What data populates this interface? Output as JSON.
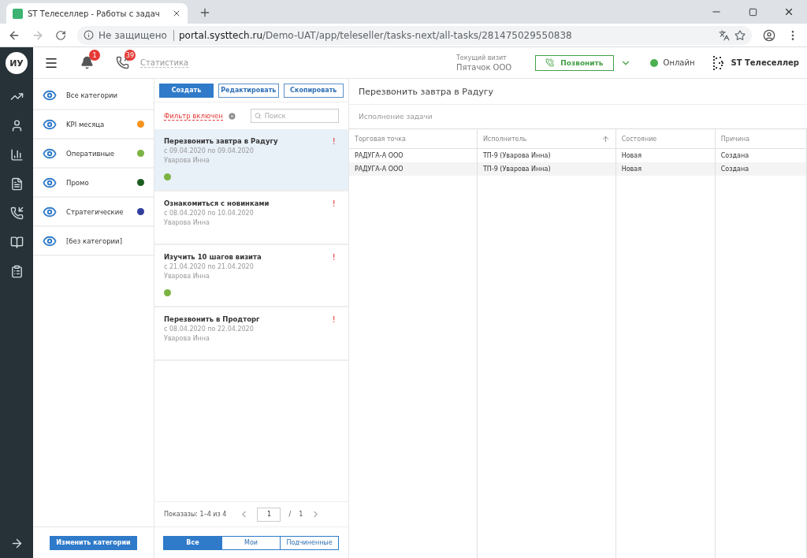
{
  "browser": {
    "tab_title": "ST Телеселлер - Работы с задач",
    "security": "Не защищено",
    "url_host": "portal.systtech.ru",
    "url_path": "/Demo-UAT/app/teleseller/tasks-next/all-tasks/281475029550838"
  },
  "header": {
    "avatar": "ИУ",
    "notifications": "1",
    "missed_calls": "39",
    "stats_link": "Статистика",
    "visit_label": "Текущий визит",
    "visit_value": "Пятачок ООО",
    "call_button": "Позвонить",
    "status": "Онлайн",
    "status_on": true,
    "brand": "ST Телеселлер"
  },
  "categories": [
    {
      "label": "Все категории",
      "visible": true
    },
    {
      "label": "KPI месяца",
      "visible": true,
      "color": "#f7931e"
    },
    {
      "label": "Оперативные",
      "visible": true,
      "color": "#7cb342"
    },
    {
      "label": "Промо",
      "visible": true,
      "color": "#1b5e20"
    },
    {
      "label": "Стратегические",
      "visible": true,
      "color": "#303f9f"
    },
    {
      "label": "[без категории]",
      "visible": true
    }
  ],
  "edit_categories_button": "Изменить категории",
  "toolbar": [
    "Создать",
    "Редактировать",
    "Скопировать"
  ],
  "filter": {
    "label": "Фильтр включен",
    "search_placeholder": "Поиск"
  },
  "tasks": [
    {
      "title": "Перезвонить завтра в Радугу",
      "dates": "с 09.04.2020 по 09.04.2020",
      "assignee": "Уварова Инна",
      "mark": "!",
      "selected": true,
      "color": "#7cb342"
    },
    {
      "title": "Ознакомиться с новинками",
      "dates": "с 08.04.2020 по 10.04.2020",
      "assignee": "Уварова Инна",
      "mark": "!",
      "selected": false
    },
    {
      "title": "Изучить 10 шагов визита",
      "dates": "с 21.04.2020 по 21.04.2020",
      "assignee": "Уварова Инна",
      "mark": "!",
      "selected": false,
      "color": "#7cb342"
    },
    {
      "title": "Перезвонить в Продторг",
      "dates": "с 08.04.2020 по 22.04.2020",
      "assignee": "Уварова Инна",
      "mark": "!",
      "selected": false
    }
  ],
  "pager": {
    "shown": "Показазы: 1–4 из 4",
    "page": "1",
    "separator": "/",
    "total": "1"
  },
  "scope_tabs": [
    {
      "label": "Все",
      "selected": true
    },
    {
      "label": "Мои",
      "selected": false
    },
    {
      "label": "Подчиненные",
      "selected": false
    }
  ],
  "detail": {
    "title": "Перезвонить завтра в Радугу",
    "section": "Исполнение задачи"
  },
  "table": {
    "columns": [
      {
        "label": "Торговая точка",
        "sorted": false
      },
      {
        "label": "Исполнитель",
        "sorted": true
      },
      {
        "label": "Состояние",
        "sorted": false
      },
      {
        "label": "Причина",
        "sorted": false
      }
    ],
    "rows": [
      [
        "РАДУГА-А ООО",
        "ТП-9 (Уварова Инна)",
        "Новая",
        "Создана"
      ],
      [
        "РАДУГА-А ООО",
        "ТП-9 (Уварова Инна)",
        "Новая",
        "Создана"
      ]
    ]
  }
}
